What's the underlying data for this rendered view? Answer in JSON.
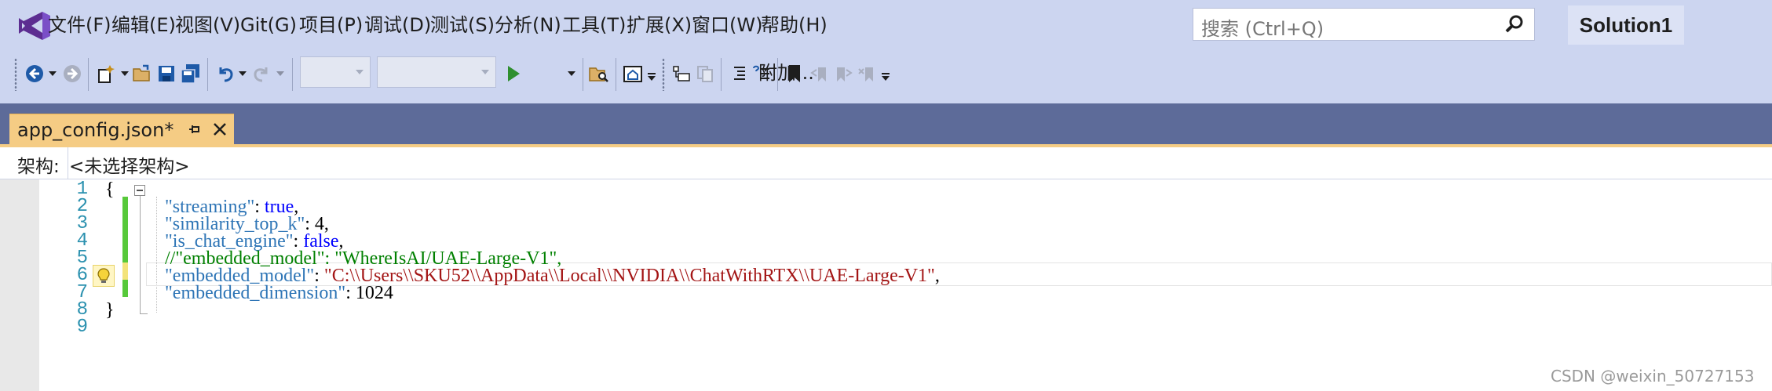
{
  "menu": {
    "items": [
      "文件(F)",
      "编辑(E)",
      "视图(V)",
      "Git(G)",
      "项目(P)",
      "调试(D)",
      "测试(S)",
      "分析(N)",
      "工具(T)",
      "扩展(X)",
      "窗口(W)",
      "帮助(H)"
    ],
    "search_placeholder": "搜索 (Ctrl+Q)",
    "solution_name": "Solution1"
  },
  "toolbar": {
    "attach_label": "附加...",
    "config_combo_value": "",
    "platform_combo_value": ""
  },
  "tab": {
    "title": "app_config.json*"
  },
  "navbar": {
    "arch_label": "架构:",
    "arch_value": "<未选择架构>"
  },
  "editor": {
    "line_numbers": [
      "1",
      "2",
      "3",
      "4",
      "5",
      "6",
      "7",
      "8",
      "9"
    ],
    "lines": [
      [
        {
          "t": "{",
          "c": ""
        }
      ],
      [
        {
          "t": "\"streaming\"",
          "c": "k"
        },
        {
          "t": ": ",
          "c": ""
        },
        {
          "t": "true",
          "c": "v"
        },
        {
          "t": ",",
          "c": ""
        }
      ],
      [
        {
          "t": "\"similarity_top_k\"",
          "c": "k"
        },
        {
          "t": ": 4,",
          "c": ""
        }
      ],
      [
        {
          "t": "\"is_chat_engine\"",
          "c": "k"
        },
        {
          "t": ": ",
          "c": ""
        },
        {
          "t": "false",
          "c": "v"
        },
        {
          "t": ",",
          "c": ""
        }
      ],
      [
        {
          "t": "//\"embedded_model\": \"WhereIsAI/UAE-Large-V1\",",
          "c": "c"
        }
      ],
      [
        {
          "t": "\"embedded_model\"",
          "c": "k"
        },
        {
          "t": ": ",
          "c": ""
        },
        {
          "t": "\"C:\\\\Users\\\\SKU52\\\\AppData\\\\Local\\\\NVIDIA\\\\ChatWithRTX\\\\UAE-Large-V1\"",
          "c": "s"
        },
        {
          "t": ",",
          "c": ""
        }
      ],
      [
        {
          "t": "\"embedded_dimension\"",
          "c": "k"
        },
        {
          "t": ": 1024",
          "c": ""
        }
      ],
      [
        {
          "t": "}",
          "c": ""
        }
      ],
      [
        {
          "t": "",
          "c": ""
        }
      ]
    ]
  },
  "watermark": "CSDN @weixin_50727153",
  "colors": {
    "menubar": "#ccd5f0",
    "tab_active": "#f5cc84",
    "doc_well": "#5d6b99",
    "json_key": "#2e75b6",
    "json_string": "#a31515",
    "json_comment": "#008000",
    "json_keyword": "#0000ff",
    "line_number": "#2b91af",
    "change_saved": "#57c93a"
  }
}
